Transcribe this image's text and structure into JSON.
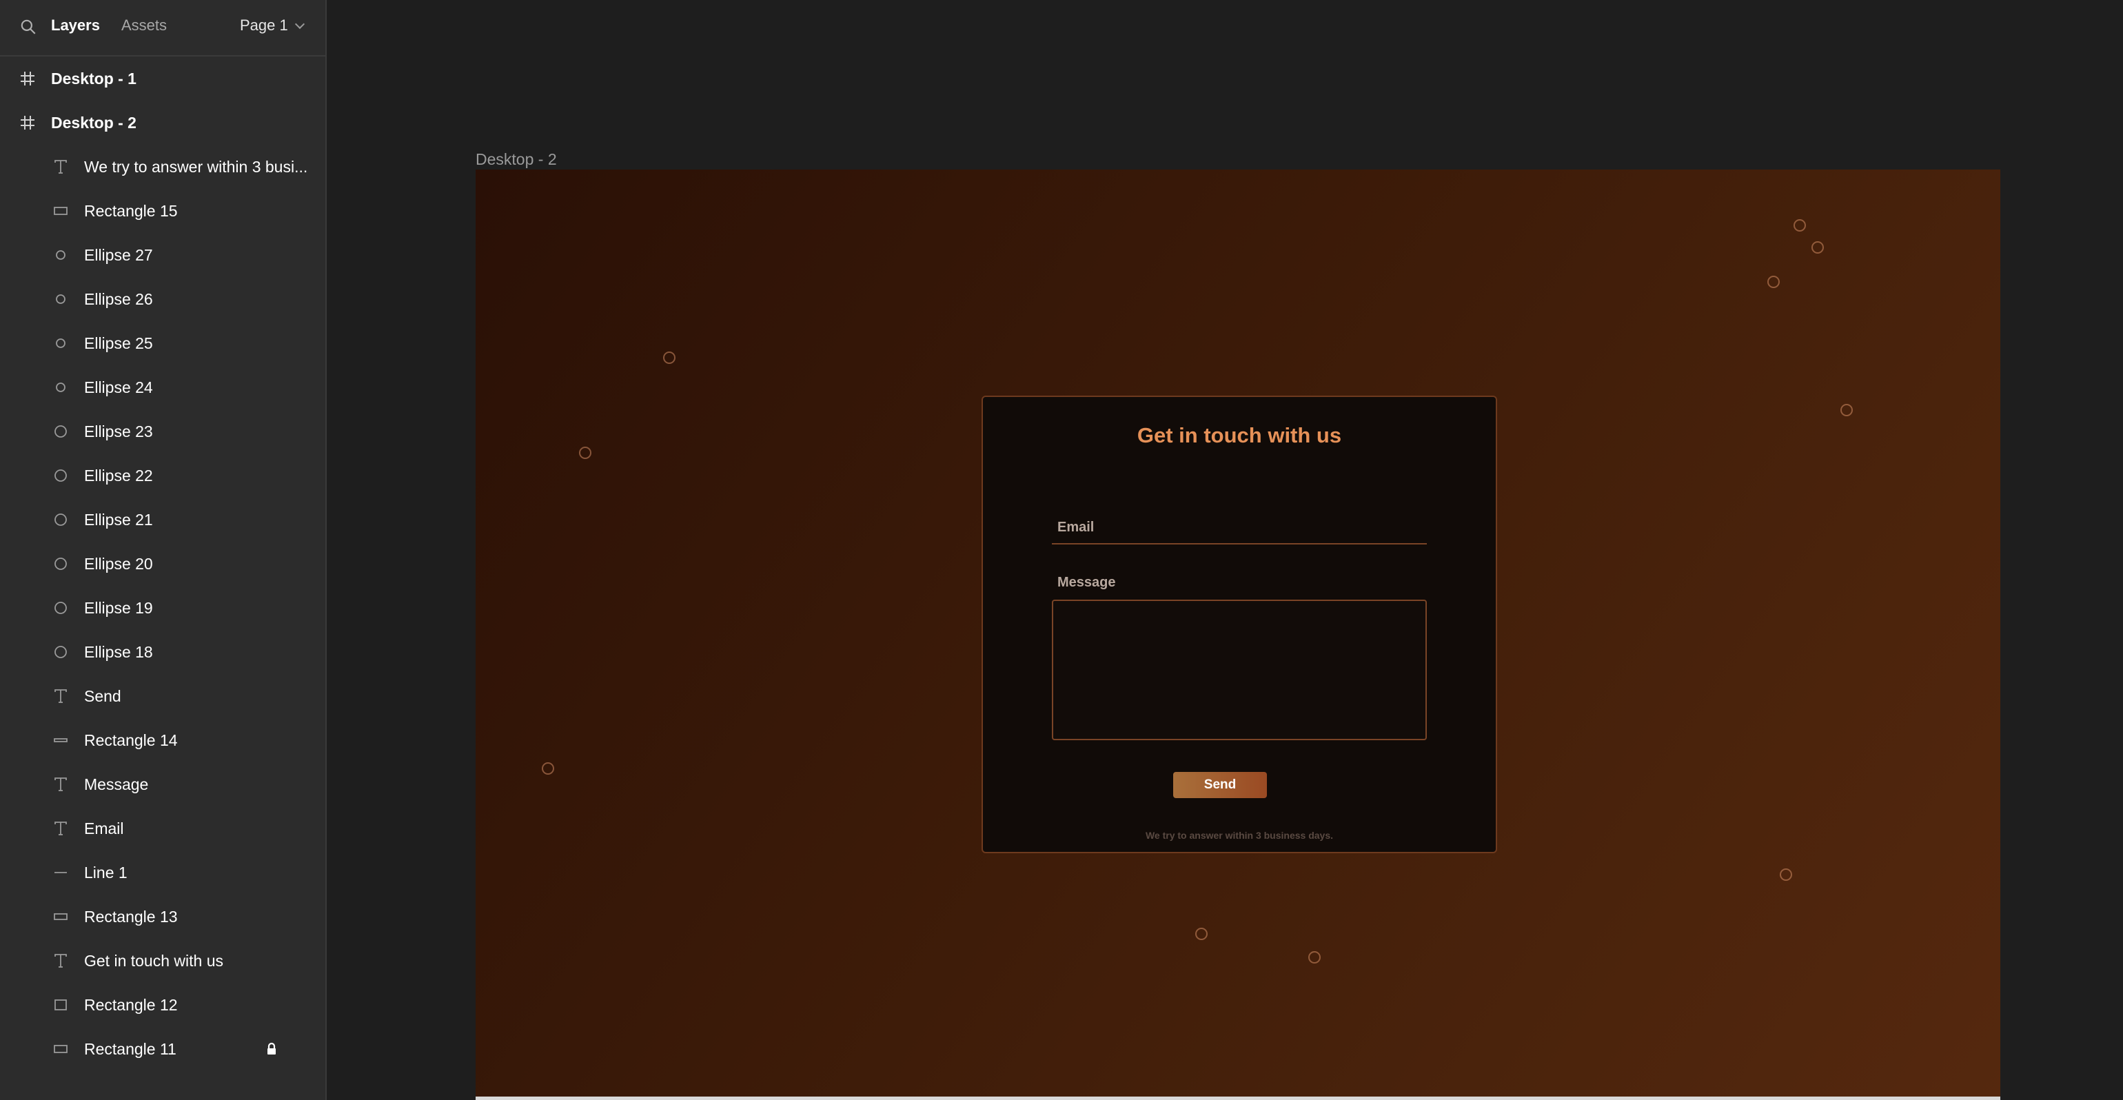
{
  "panel": {
    "tabs": {
      "layers": "Layers",
      "assets": "Assets"
    },
    "page_select": "Page 1",
    "frames": [
      {
        "label": "Desktop - 1",
        "icon": "frame-icon"
      },
      {
        "label": "Desktop - 2",
        "icon": "frame-icon"
      }
    ],
    "layers": [
      {
        "label": "We try to answer within 3 busi...",
        "icon": "text-icon"
      },
      {
        "label": "Rectangle 15",
        "icon": "rectangle-icon"
      },
      {
        "label": "Ellipse 27",
        "icon": "ellipse-icon"
      },
      {
        "label": "Ellipse 26",
        "icon": "ellipse-icon"
      },
      {
        "label": "Ellipse 25",
        "icon": "ellipse-icon"
      },
      {
        "label": "Ellipse 24",
        "icon": "ellipse-icon"
      },
      {
        "label": "Ellipse 23",
        "icon": "ellipse-icon"
      },
      {
        "label": "Ellipse 22",
        "icon": "ellipse-icon"
      },
      {
        "label": "Ellipse 21",
        "icon": "ellipse-icon"
      },
      {
        "label": "Ellipse 20",
        "icon": "ellipse-icon"
      },
      {
        "label": "Ellipse 19",
        "icon": "ellipse-icon"
      },
      {
        "label": "Ellipse 18",
        "icon": "ellipse-icon"
      },
      {
        "label": "Send",
        "icon": "text-icon"
      },
      {
        "label": "Rectangle 14",
        "icon": "rectangle-icon"
      },
      {
        "label": "Message",
        "icon": "text-icon"
      },
      {
        "label": "Email",
        "icon": "text-icon"
      },
      {
        "label": "Line 1",
        "icon": "line-icon"
      },
      {
        "label": "Rectangle 13",
        "icon": "rectangle-icon"
      },
      {
        "label": "Get in touch with us",
        "icon": "text-icon"
      },
      {
        "label": "Rectangle 12",
        "icon": "rectangle-icon"
      },
      {
        "label": "Rectangle 11",
        "icon": "rectangle-icon",
        "locked": true
      }
    ]
  },
  "canvas": {
    "frame_label": "Desktop - 2",
    "form": {
      "title": "Get in touch with us",
      "email_label": "Email",
      "message_label": "Message",
      "send_label": "Send",
      "footnote": "We try to answer within 3 business days."
    }
  },
  "colors": {
    "panel_bg": "#2c2c2c",
    "canvas_bg": "#1e1e1e",
    "title_accent": "#e69158",
    "button_gradient_start": "#a9703b",
    "button_gradient_end": "#9a4a23",
    "card_border": "#6e3a1e"
  }
}
